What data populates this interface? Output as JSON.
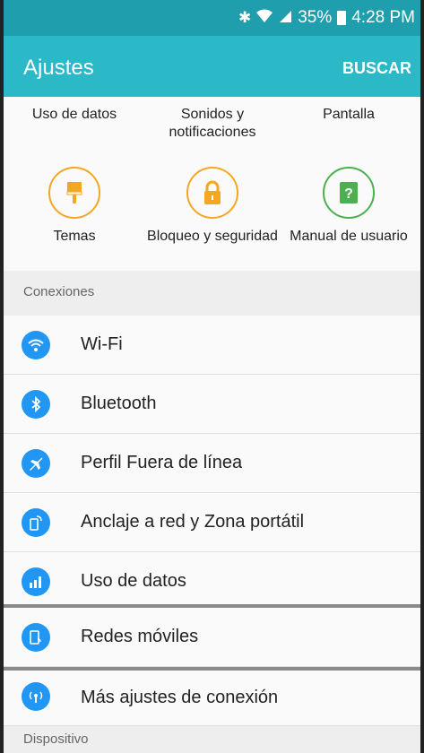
{
  "status_bar": {
    "battery": "35%",
    "time": "4:28 PM"
  },
  "header": {
    "title": "Ajustes",
    "search_label": "BUSCAR"
  },
  "quick_settings": [
    {
      "label": "Uso de datos"
    },
    {
      "label": "Sonidos y notificaciones"
    },
    {
      "label": "Pantalla"
    },
    {
      "label": "Temas",
      "icon": "paint-brush-icon"
    },
    {
      "label": "Bloqueo y seguridad",
      "icon": "lock-icon"
    },
    {
      "label": "Manual de usuario",
      "icon": "help-book-icon"
    }
  ],
  "sections": [
    {
      "title": "Conexiones"
    },
    {
      "title": "Dispositivo"
    }
  ],
  "connections": [
    {
      "label": "Wi-Fi",
      "icon": "wifi-icon"
    },
    {
      "label": "Bluetooth",
      "icon": "bluetooth-icon"
    },
    {
      "label": "Perfil Fuera de línea",
      "icon": "airplane-icon"
    },
    {
      "label": "Anclaje a red y Zona portátil",
      "icon": "hotspot-icon"
    },
    {
      "label": "Uso de datos",
      "icon": "data-usage-icon"
    },
    {
      "label": "Redes móviles",
      "icon": "mobile-network-icon"
    },
    {
      "label": "Más ajustes de conexión",
      "icon": "more-connection-icon"
    }
  ],
  "colors": {
    "header": "#2bb8c7",
    "statusbar": "#1f9fae",
    "row_icon": "#2196f3",
    "orange": "#f5a623",
    "green": "#4caf50"
  }
}
